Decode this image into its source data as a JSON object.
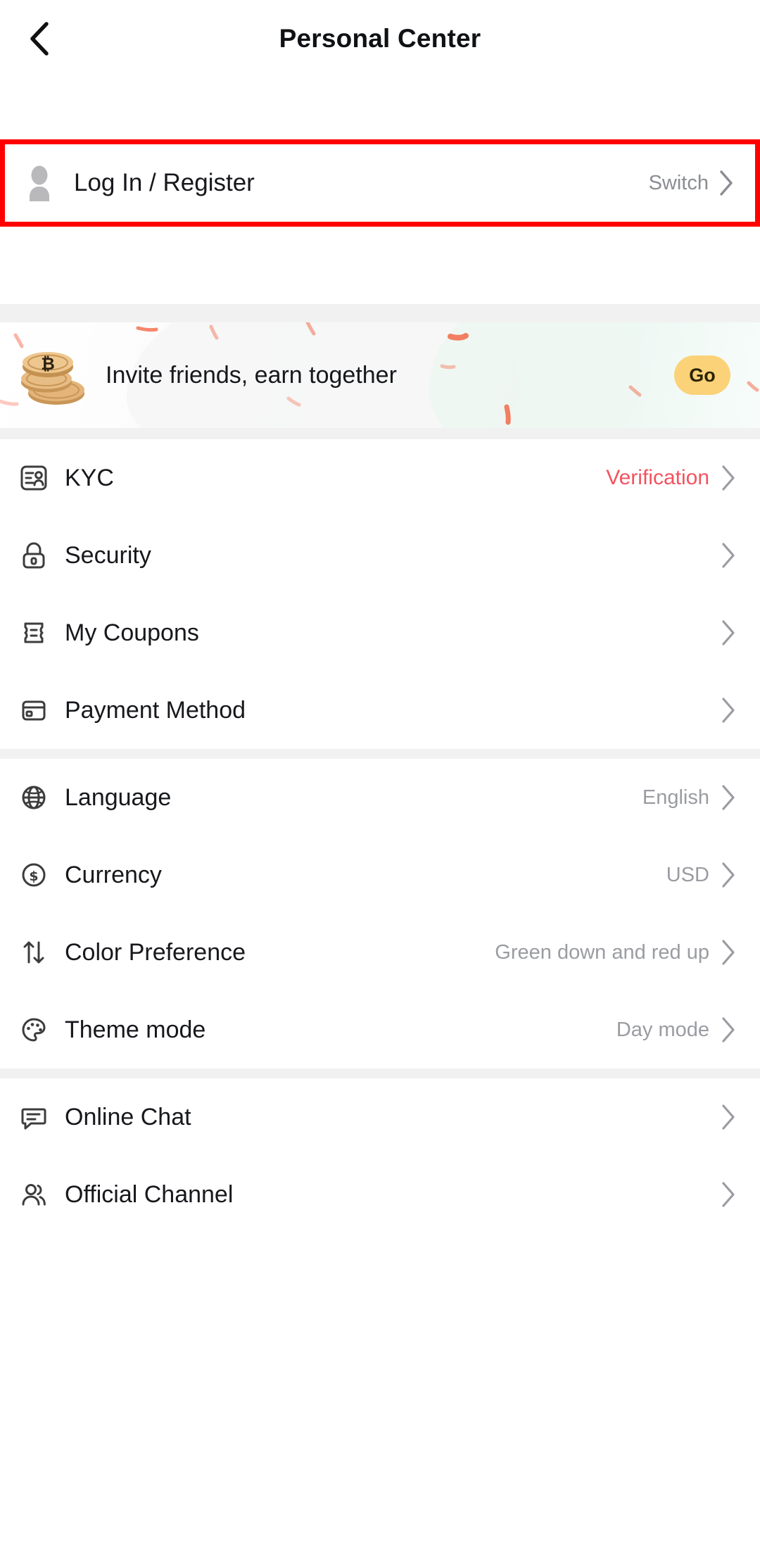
{
  "header": {
    "title": "Personal Center",
    "back_icon": "chevron-left-icon"
  },
  "account": {
    "avatar_icon": "user-avatar-icon",
    "label": "Log In / Register",
    "action_label": "Switch",
    "chevron_icon": "chevron-right-icon",
    "highlight_color": "#fe0000"
  },
  "banner": {
    "icon": "bitcoin-coins-icon",
    "text": "Invite friends, earn together",
    "button_label": "Go",
    "button_color": "#fbd278",
    "confetti_color": "#f4603f"
  },
  "groups": [
    {
      "items": [
        {
          "icon": "id-card-icon",
          "label": "KYC",
          "value": "Verification",
          "value_style": "accent"
        },
        {
          "icon": "lock-icon",
          "label": "Security",
          "value": ""
        },
        {
          "icon": "ticket-icon",
          "label": "My Coupons",
          "value": ""
        },
        {
          "icon": "credit-card-icon",
          "label": "Payment Method",
          "value": ""
        }
      ]
    },
    {
      "items": [
        {
          "icon": "globe-icon",
          "label": "Language",
          "value": "English"
        },
        {
          "icon": "dollar-circle-icon",
          "label": "Currency",
          "value": "USD"
        },
        {
          "icon": "updown-arrows-icon",
          "label": "Color Preference",
          "value": "Green down and red up"
        },
        {
          "icon": "palette-icon",
          "label": "Theme mode",
          "value": "Day mode"
        }
      ]
    },
    {
      "items": [
        {
          "icon": "chat-bubble-icon",
          "label": "Online Chat",
          "value": ""
        },
        {
          "icon": "users-icon",
          "label": "Official Channel",
          "value": ""
        }
      ]
    }
  ],
  "colors": {
    "text_primary": "#17181c",
    "text_secondary": "#9a9ca1",
    "accent_red": "#f5525f",
    "separator": "#f1f1f1"
  }
}
